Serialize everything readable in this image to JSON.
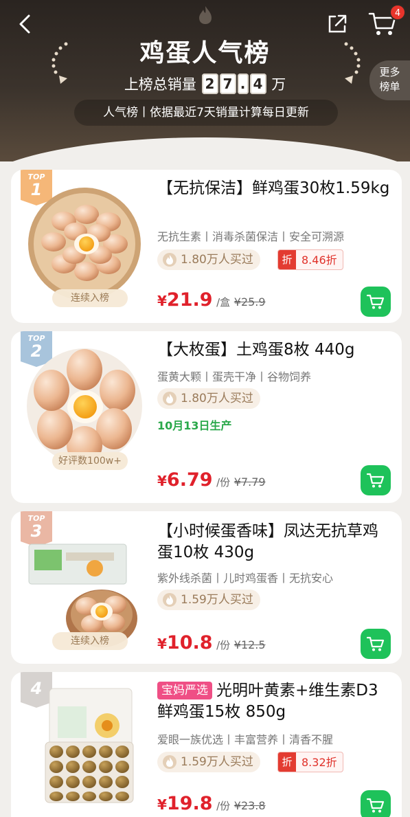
{
  "header": {
    "title": "鸡蛋人气榜",
    "sales_prefix": "上榜总销量",
    "sales_digits": [
      "2",
      "7",
      ".",
      "4"
    ],
    "sales_suffix": "万",
    "rank_note": "人气榜丨依据最近7天销量计算每日更新",
    "more_line1": "更多",
    "more_line2": "榜单",
    "cart_count": "4"
  },
  "products": [
    {
      "rank_top": "TOP",
      "rank_num": "1",
      "img_tag": "连续入榜",
      "name": "【无抗保洁】鲜鸡蛋30枚1.59kg",
      "features": "无抗生素丨消毒杀菌保洁丨安全可溯源",
      "sold": "1.80万人买过",
      "discount_mark": "折",
      "discount": "8.46折",
      "price_yen": "¥",
      "price": "21.9",
      "unit": "/盒",
      "original_price": "¥25.9"
    },
    {
      "rank_top": "TOP",
      "rank_num": "2",
      "img_tag": "好评数100w+",
      "name": "【大枚蛋】土鸡蛋8枚 440g",
      "features": "蛋黄大颗丨蛋壳干净丨谷物饲养",
      "sold": "1.80万人买过",
      "production_date": "10月13日生产",
      "price_yen": "¥",
      "price": "6.79",
      "unit": "/份",
      "original_price": "¥7.79"
    },
    {
      "rank_top": "TOP",
      "rank_num": "3",
      "img_tag": "连续入榜",
      "name": "【小时候蛋香味】凤达无抗草鸡蛋10枚 430g",
      "features": "紫外线杀菌丨儿时鸡蛋香丨无抗安心",
      "sold": "1.59万人买过",
      "price_yen": "¥",
      "price": "10.8",
      "unit": "/份",
      "original_price": "¥12.5"
    },
    {
      "rank_num": "4",
      "promo_badge": "宝妈严选",
      "name": "光明叶黄素+维生素D3鲜鸡蛋15枚 850g",
      "features": "爱眼一族优选丨丰富营养丨清香不腥",
      "sold": "1.59万人买过",
      "discount_mark": "折",
      "discount": "8.32折",
      "price_yen": "¥",
      "price": "19.8",
      "unit": "/份",
      "original_price": "¥23.8"
    }
  ]
}
